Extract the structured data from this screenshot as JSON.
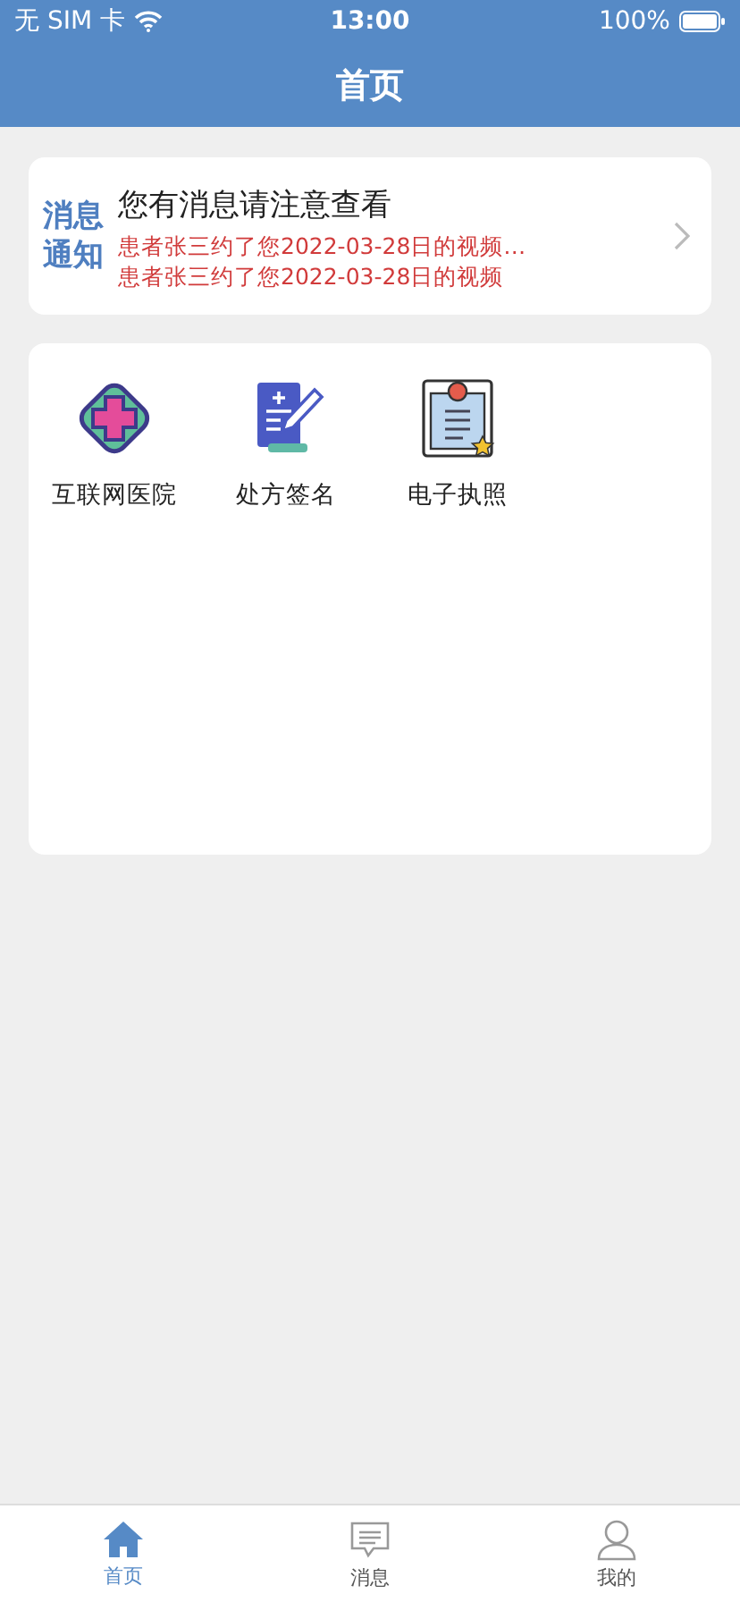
{
  "status_bar": {
    "carrier": "无 SIM 卡",
    "time": "13:00",
    "battery": "100%"
  },
  "nav_bar": {
    "title": "首页"
  },
  "notice": {
    "badge_top": "消息",
    "badge_bottom": "通知",
    "title": "您有消息请注意查看",
    "messages": [
      "患者张三约了您2022-03-28日的视频…",
      "患者张三约了您2022-03-28日的视频"
    ]
  },
  "services": [
    {
      "kind": "hospital",
      "label": "互联网医院"
    },
    {
      "kind": "prescription",
      "label": "处方签名"
    },
    {
      "kind": "license",
      "label": "电子执照"
    }
  ],
  "tab_bar": [
    {
      "kind": "home",
      "label": "首页",
      "selected": true
    },
    {
      "kind": "message",
      "label": "消息",
      "selected": false
    },
    {
      "kind": "profile",
      "label": "我的",
      "selected": false
    }
  ]
}
